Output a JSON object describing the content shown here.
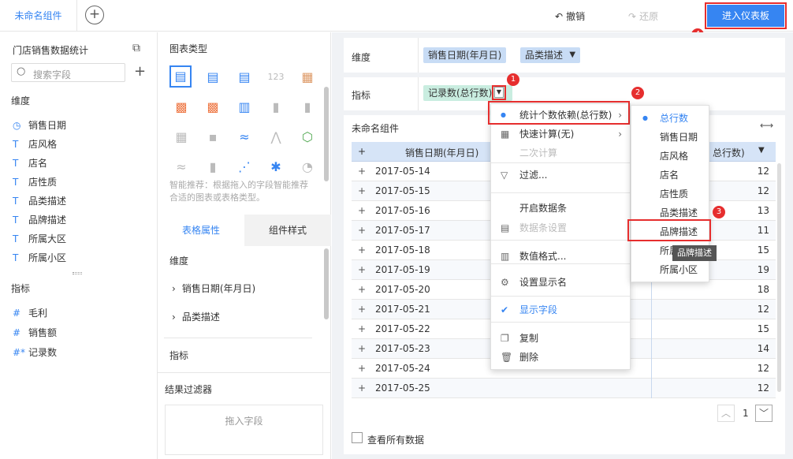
{
  "tab": {
    "title": "未命名组件",
    "add_icon": "plus-circle-icon"
  },
  "toolbar": {
    "undo": "撤销",
    "redo": "还原",
    "enter": "进入仪表板"
  },
  "badges": [
    "1",
    "2",
    "3",
    "4"
  ],
  "left": {
    "dataset": "门店销售数据统计",
    "search_placeholder": "搜索字段",
    "dims_label": "维度",
    "dims": [
      {
        "icon": "clock-icon",
        "glyph": "◷",
        "label": "销售日期"
      },
      {
        "icon": "text-icon",
        "glyph": "T",
        "label": "店风格"
      },
      {
        "icon": "text-icon",
        "glyph": "T",
        "label": "店名"
      },
      {
        "icon": "text-icon",
        "glyph": "T",
        "label": "店性质"
      },
      {
        "icon": "text-icon",
        "glyph": "T",
        "label": "品类描述"
      },
      {
        "icon": "text-icon",
        "glyph": "T",
        "label": "品牌描述"
      },
      {
        "icon": "text-icon",
        "glyph": "T",
        "label": "所属大区"
      },
      {
        "icon": "text-icon",
        "glyph": "T",
        "label": "所属小区"
      }
    ],
    "metrics_label": "指标",
    "metrics": [
      {
        "icon": "hash-icon",
        "glyph": "#",
        "label": "毛利"
      },
      {
        "icon": "hash-icon",
        "glyph": "#",
        "label": "销售额"
      },
      {
        "icon": "hash-icon",
        "glyph": "#*",
        "label": "记录数"
      }
    ]
  },
  "mid": {
    "chart_type_label": "图表类型",
    "hint": "智能推荐：根据拖入的字段智能推荐合适的图表或表格类型。",
    "tabs": [
      "表格属性",
      "组件样式"
    ],
    "dims_label": "维度",
    "dims": [
      "销售日期(年月日)",
      "品类描述"
    ],
    "metrics_label": "指标",
    "filter_label": "结果过滤器",
    "drop_label": "拖入字段"
  },
  "main": {
    "dim_label": "维度",
    "dim_pills": [
      "销售日期(年月日)",
      "品类描述"
    ],
    "metric_label": "指标",
    "metric_pill": "记录数(总行数)",
    "component_title": "未命名组件",
    "col1": "销售日期(年月日)",
    "col2": "总行数)",
    "rows": [
      {
        "date": "2017-05-14",
        "val": "12"
      },
      {
        "date": "2017-05-15",
        "val": "12"
      },
      {
        "date": "2017-05-16",
        "val": "13"
      },
      {
        "date": "2017-05-17",
        "val": "11"
      },
      {
        "date": "2017-05-18",
        "val": "15"
      },
      {
        "date": "2017-05-19",
        "val": "19"
      },
      {
        "date": "2017-05-20",
        "val": "18"
      },
      {
        "date": "2017-05-21",
        "val": "12"
      },
      {
        "date": "2017-05-22",
        "val": "15"
      },
      {
        "date": "2017-05-23",
        "val": "14"
      },
      {
        "date": "2017-05-24",
        "val": "12"
      },
      {
        "date": "2017-05-25",
        "val": "12"
      }
    ],
    "page": "1",
    "show_all": "查看所有数据"
  },
  "menu": {
    "items": [
      {
        "icon": "dot-icon",
        "glyph": "●",
        "label": "统计个数依赖(总行数)",
        "arrow": ">"
      },
      {
        "icon": "calc-icon",
        "glyph": "▦",
        "label": "快速计算(无)",
        "arrow": ">"
      },
      {
        "icon": "",
        "glyph": "",
        "label": "二次计算",
        "arrow": ""
      },
      {
        "icon": "filter-icon",
        "glyph": "▽",
        "label": "过滤...",
        "arrow": ""
      },
      {
        "icon": "",
        "glyph": "",
        "label": "开启数据条",
        "arrow": ""
      },
      {
        "icon": "databar-icon",
        "glyph": "▤",
        "label": "数据条设置",
        "arrow": ""
      },
      {
        "icon": "format-icon",
        "glyph": "▥",
        "label": "数值格式...",
        "arrow": ""
      },
      {
        "icon": "gear-icon",
        "glyph": "⚙",
        "label": "设置显示名",
        "arrow": ""
      },
      {
        "icon": "check-icon",
        "glyph": "✔",
        "label": "显示字段",
        "arrow": ""
      },
      {
        "icon": "copy-icon",
        "glyph": "❐",
        "label": "复制",
        "arrow": ""
      },
      {
        "icon": "trash-icon",
        "glyph": "🗑",
        "label": "删除",
        "arrow": ""
      }
    ]
  },
  "submenu": {
    "items": [
      "总行数",
      "销售日期",
      "店风格",
      "店名",
      "店性质",
      "品类描述",
      "品牌描述",
      "所属大区",
      "所属小区"
    ],
    "tooltip": "品牌描述"
  },
  "colors": {
    "accent": "#3685f2",
    "red": "#e62e2e",
    "green": "#c9ede0"
  }
}
